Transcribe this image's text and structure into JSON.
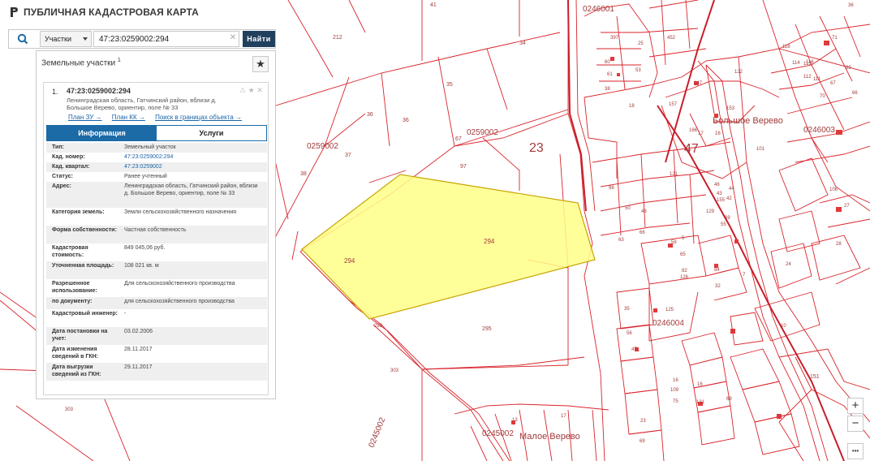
{
  "header": {
    "title": "ПУБЛИЧНАЯ КАДАСТРОВАЯ КАРТА"
  },
  "search": {
    "type_label": "Участки",
    "value": "47:23:0259002:294",
    "button_label": "Найти"
  },
  "panel": {
    "title": "Земельные участки",
    "count": "1",
    "card": {
      "index": "1.",
      "number": "47:23:0259002:294",
      "address": "Ленинградская область, Гатчинский район, вблизи д. Большое Верево, ориентир, поле № 33",
      "links": [
        "План ЗУ →",
        "План КК →",
        "Поиск в границах объекта →"
      ],
      "tabs": [
        "Информация",
        "Услуги"
      ],
      "attributes": [
        {
          "key": "Тип:",
          "value": "Земельный участок",
          "link": false
        },
        {
          "key": "Кад. номер:",
          "value": "47:23:0259002:294",
          "link": true
        },
        {
          "key": "Кад. квартал:",
          "value": "47:23:0259002",
          "link": true
        },
        {
          "key": "Статус:",
          "value": "Ранее учтенный",
          "link": false
        },
        {
          "key": "Адрес:",
          "value": "Ленинградская область, Гатчинский район, вблизи д. Большое Верево, ориентир, поле № 33",
          "link": false
        },
        {
          "key": "Категория земель:",
          "value": "Земли сельскохозяйственного назначения",
          "link": false
        },
        {
          "key": "Форма собственности:",
          "value": "Частная собственность",
          "link": false
        },
        {
          "key": "Кадастровая стоимость:",
          "value": "849 045,06 руб.",
          "link": false
        },
        {
          "key": "Уточненная площадь:",
          "value": "108 021 кв. м",
          "link": false
        },
        {
          "key": "Разрешенное использование:",
          "value": "Для сельскохозяйственного производства",
          "link": false
        },
        {
          "key": "по документу:",
          "value": "для сельскохозяйственного производства",
          "link": false
        },
        {
          "key": "Кадастровый инженер:",
          "value": "-",
          "link": false
        },
        {
          "key": "Дата постановки на учет:",
          "value": "03.02.2006",
          "link": false
        },
        {
          "key": "Дата изменения сведений в ГКН:",
          "value": "28.11.2017",
          "link": false
        },
        {
          "key": "Дата выгрузки сведений из ГКН:",
          "value": "29.11.2017",
          "link": false
        }
      ]
    }
  },
  "map": {
    "colors": {
      "boundary": "#d9242b",
      "selected_fill": "#ffff88",
      "selected_stroke": "#c8a400",
      "label": "#a23b3b"
    },
    "place_names": [
      {
        "text": "Большое Верево"
      },
      {
        "text": "Малое Верево"
      }
    ],
    "quarter_labels": [
      "0259002",
      "0259002",
      "0246001",
      "0246003",
      "0246004",
      "0245002",
      "0245002"
    ],
    "district_labels": [
      "23",
      "47"
    ],
    "selected_parcel_labels": [
      "294",
      "294"
    ],
    "parcel_labels": [
      "105",
      "212",
      "41",
      "34",
      "35",
      "36",
      "36",
      "37",
      "38",
      "67",
      "97",
      "295",
      "293",
      "303",
      "303",
      "397",
      "25",
      "452",
      "60",
      "61",
      "53",
      "38",
      "18",
      "147",
      "166",
      "153",
      "157",
      "16",
      "17",
      "122",
      "118",
      "116",
      "114",
      "113",
      "112",
      "111",
      "39",
      "36",
      "71",
      "70",
      "67",
      "66",
      "98",
      "50",
      "48",
      "121",
      "66",
      "58",
      "46",
      "44",
      "43",
      "42",
      "155",
      "129",
      "69",
      "65",
      "55",
      "63",
      "126",
      "32",
      "82",
      "5",
      "84",
      "35",
      "125",
      "56",
      "47",
      "16",
      "109",
      "75",
      "23",
      "69",
      "16",
      "131",
      "69",
      "13",
      "17",
      "151",
      "7",
      "28",
      "27",
      "24",
      "10",
      "101",
      "106"
    ],
    "zoom": {
      "in": "+",
      "out": "−",
      "more": "•••"
    }
  }
}
